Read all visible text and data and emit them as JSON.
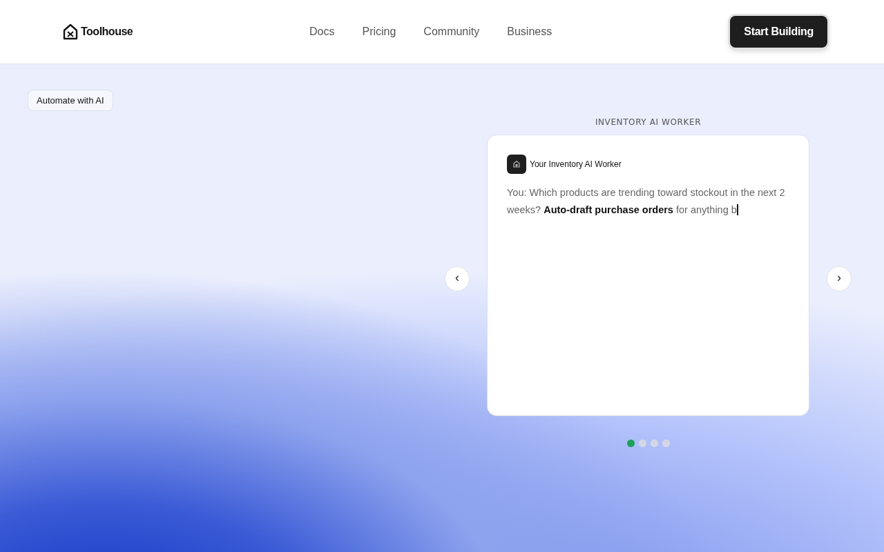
{
  "header": {
    "logo": "Toolhouse",
    "nav": [
      "Docs",
      "Pricing",
      "Community",
      "Business"
    ],
    "cta": "Start Building"
  },
  "hero": {
    "badge": "Automate with AI",
    "carousel": {
      "title": "INVENTORY AI WORKER",
      "prev": "‹",
      "next": "›",
      "card": {
        "agent_name": "Your Inventory AI Worker",
        "message": "You: Which products are trending toward stockout in the next 2 weeks? **Auto-draft purchase orders** for anything b"
      },
      "dots": [
        {
          "selected": true
        },
        {
          "selected": false
        },
        {
          "selected": false
        },
        {
          "selected": false
        }
      ]
    }
  }
}
